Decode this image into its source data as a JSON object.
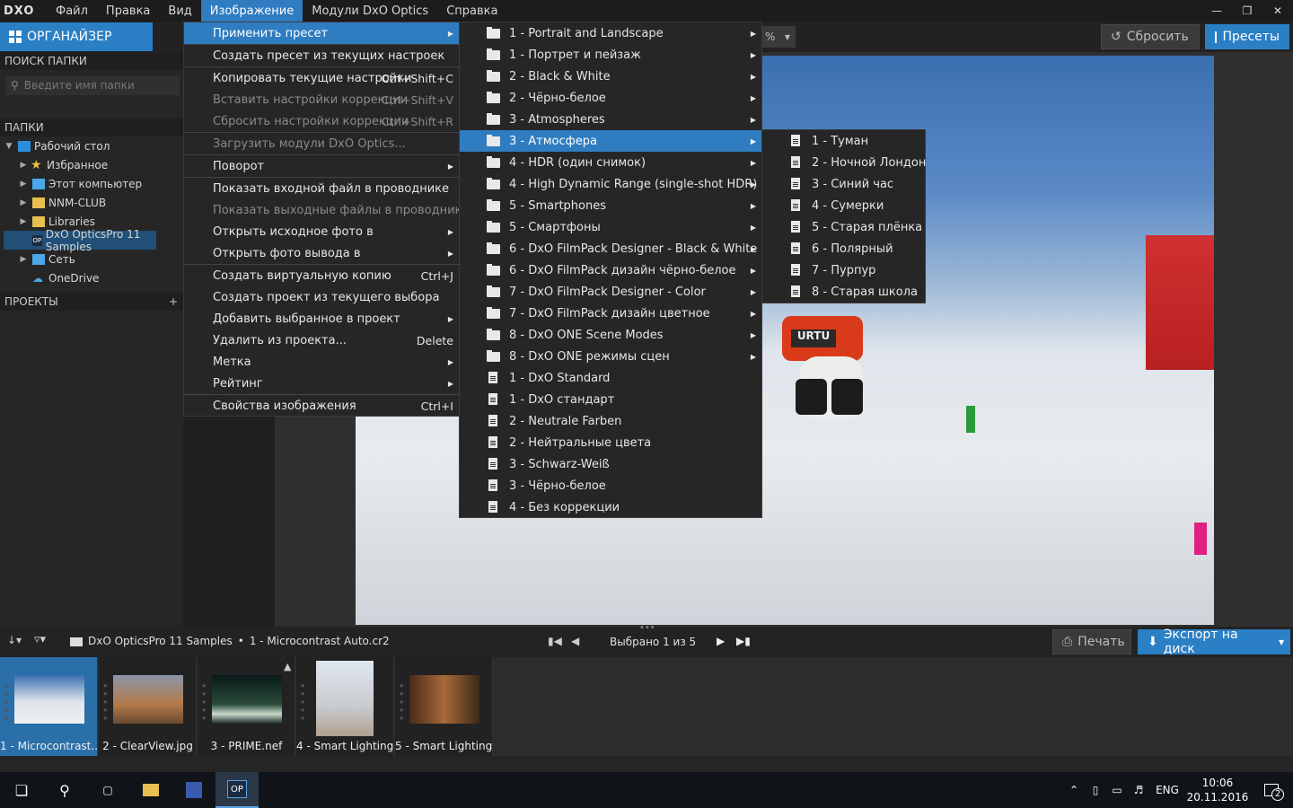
{
  "menubar": {
    "logo": "DXO",
    "items": [
      "Файл",
      "Правка",
      "Вид",
      "Изображение",
      "Модули DxO Optics",
      "Справка"
    ],
    "active_index": 3
  },
  "toolbar": {
    "organizer_label": "ОРГАНАЙЗЕР",
    "zoom_suffix": "%",
    "reset_label": "Сбросить",
    "presets_label": "Пресеты"
  },
  "left": {
    "folder_search_header": "ПОИСК ПАПКИ",
    "search_placeholder": "Введите имя папки",
    "folders_header": "ПАПКИ",
    "tree": [
      {
        "label": "Рабочий стол",
        "expanded": true
      },
      {
        "label": "Избранное"
      },
      {
        "label": "Этот компьютер"
      },
      {
        "label": "NNM-CLUB"
      },
      {
        "label": "Libraries"
      },
      {
        "label": "DxO OpticsPro 11 Samples",
        "selected": true
      },
      {
        "label": "Сеть"
      },
      {
        "label": "OneDrive"
      }
    ],
    "projects_header": "ПРОЕКТЫ",
    "projects_add": "+"
  },
  "image_menu": {
    "items": [
      {
        "label": "Применить пресет",
        "submenu": true,
        "highlighted": true
      },
      {
        "label": "Создать пресет из текущих настроек"
      },
      {
        "label": "Копировать текущие настройки",
        "shortcut": "Ctrl+Shift+C"
      },
      {
        "label": "Вставить настройки коррекции",
        "shortcut": "Ctrl+Shift+V",
        "disabled": true
      },
      {
        "label": "Сбросить настройки коррекции",
        "shortcut": "Ctrl+Shift+R",
        "disabled": true
      },
      {
        "label": "Загрузить модули DxO Optics...",
        "disabled": true
      },
      {
        "label": "Поворот",
        "submenu": true
      },
      {
        "label": "Показать входной файл в проводнике"
      },
      {
        "label": "Показать выходные файлы в проводнике",
        "disabled": true
      },
      {
        "label": "Открыть исходное фото в",
        "submenu": true
      },
      {
        "label": "Открыть фото вывода в",
        "submenu": true
      },
      {
        "label": "Создать виртуальную копию",
        "shortcut": "Ctrl+J"
      },
      {
        "label": "Создать проект из текущего выбора"
      },
      {
        "label": "Добавить выбранное в проект",
        "submenu": true
      },
      {
        "label": "Удалить из проекта...",
        "shortcut": "Delete"
      },
      {
        "label": "Метка",
        "submenu": true
      },
      {
        "label": "Рейтинг",
        "submenu": true
      },
      {
        "label": "Свойства изображения",
        "shortcut": "Ctrl+I"
      }
    ]
  },
  "preset_menu": {
    "items": [
      {
        "label": "1 - Portrait and Landscape",
        "folder": true
      },
      {
        "label": "1 - Портрет и пейзаж",
        "folder": true
      },
      {
        "label": "2 - Black & White",
        "folder": true
      },
      {
        "label": "2 - Чёрно-белое",
        "folder": true
      },
      {
        "label": "3 - Atmospheres",
        "folder": true
      },
      {
        "label": "3 - Атмосфера",
        "folder": true,
        "highlighted": true
      },
      {
        "label": "4 - HDR (один снимок)",
        "folder": true
      },
      {
        "label": "4 - High Dynamic Range (single-shot HDR)",
        "folder": true
      },
      {
        "label": "5 - Smartphones",
        "folder": true
      },
      {
        "label": "5 - Смартфоны",
        "folder": true
      },
      {
        "label": "6 - DxO FilmPack Designer - Black & White",
        "folder": true
      },
      {
        "label": "6 - DxO FilmPack дизайн чёрно-белое",
        "folder": true
      },
      {
        "label": "7 - DxO FilmPack Designer - Color",
        "folder": true
      },
      {
        "label": "7 - DxO FilmPack дизайн цветное",
        "folder": true
      },
      {
        "label": "8 - DxO ONE Scene Modes",
        "folder": true
      },
      {
        "label": "8 - DxO ONE режимы сцен",
        "folder": true
      },
      {
        "label": "1 - DxO Standard"
      },
      {
        "label": "1 - DxO стандарт"
      },
      {
        "label": "2 - Neutrale Farben"
      },
      {
        "label": "2 - Нейтральные цвета"
      },
      {
        "label": "3 - Schwarz-Weiß"
      },
      {
        "label": "3 - Чёрно-белое"
      },
      {
        "label": "4 - Без коррекции"
      }
    ]
  },
  "atmosphere_menu": {
    "items": [
      "1 - Туман",
      "2 - Ночной Лондон",
      "3 - Синий час",
      "4 - Сумерки",
      "5 - Старая плёнка",
      "6 - Полярный",
      "7 - Пурпур",
      "8 - Старая школа"
    ]
  },
  "navbar": {
    "breadcrumb": "DxO OpticsPro 11 Samples",
    "bullet": "•",
    "current_file": "1 - Microcontrast Auto.cr2",
    "selection_text": "Выбрано 1 из 5",
    "print_label": "Печать",
    "export_label": "Экспорт на диск"
  },
  "filmstrip": {
    "thumbs": [
      "1 - Microcontrast...",
      "2 - ClearView.jpg",
      "3 - PRIME.nef",
      "4 - Smart Lighting...",
      "5 - Smart Lighting..."
    ],
    "selected_index": 0
  },
  "taskbar": {
    "lang": "ENG",
    "time": "10:06",
    "date": "20.11.2016",
    "notif_count": "2",
    "app_badge": "OP"
  },
  "colors": {
    "accent": "#2f7cc0",
    "organizer": "#2a7fc5",
    "menu_bg": "#262626"
  }
}
